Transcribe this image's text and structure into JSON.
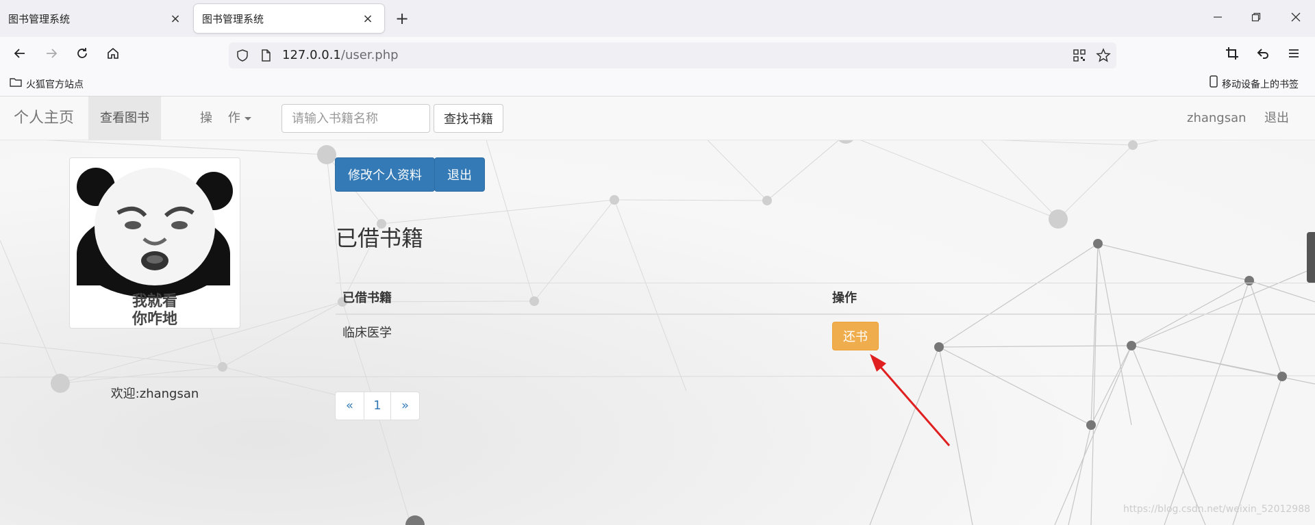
{
  "browser": {
    "tabs": [
      {
        "title": "图书管理系统",
        "close": "×"
      },
      {
        "title": "图书管理系统",
        "close": "×"
      }
    ],
    "new_tab": "+",
    "url_host": "127.0.0.1",
    "url_path": "/user.php",
    "bookmarks": {
      "left": "火狐官方站点",
      "right": "移动设备上的书签"
    }
  },
  "site_nav": {
    "brand": "个人主页",
    "active_item": "查看图书",
    "dropdown": "操    作",
    "search_placeholder": "请输入书籍名称",
    "search_button": "查找书籍",
    "username": "zhangsan",
    "logout": "退出"
  },
  "sidebar": {
    "welcome": "欢迎:zhangsan",
    "caption_line1": "我就看",
    "caption_line2": "你咋地"
  },
  "main": {
    "edit_profile": "修改个人资料",
    "logout_button": "退出",
    "heading": "已借书籍",
    "table": {
      "headers": [
        "已借书籍",
        "操作"
      ],
      "rows": [
        {
          "book": "临床医学",
          "action": "还书"
        }
      ]
    },
    "pagination": [
      "«",
      "1",
      "»"
    ]
  },
  "watermark": "https://blog.csdn.net/weixin_52012988",
  "colors": {
    "primary": "#337ab7",
    "warning": "#f0ad4e",
    "annotation_arrow": "#e02020"
  }
}
